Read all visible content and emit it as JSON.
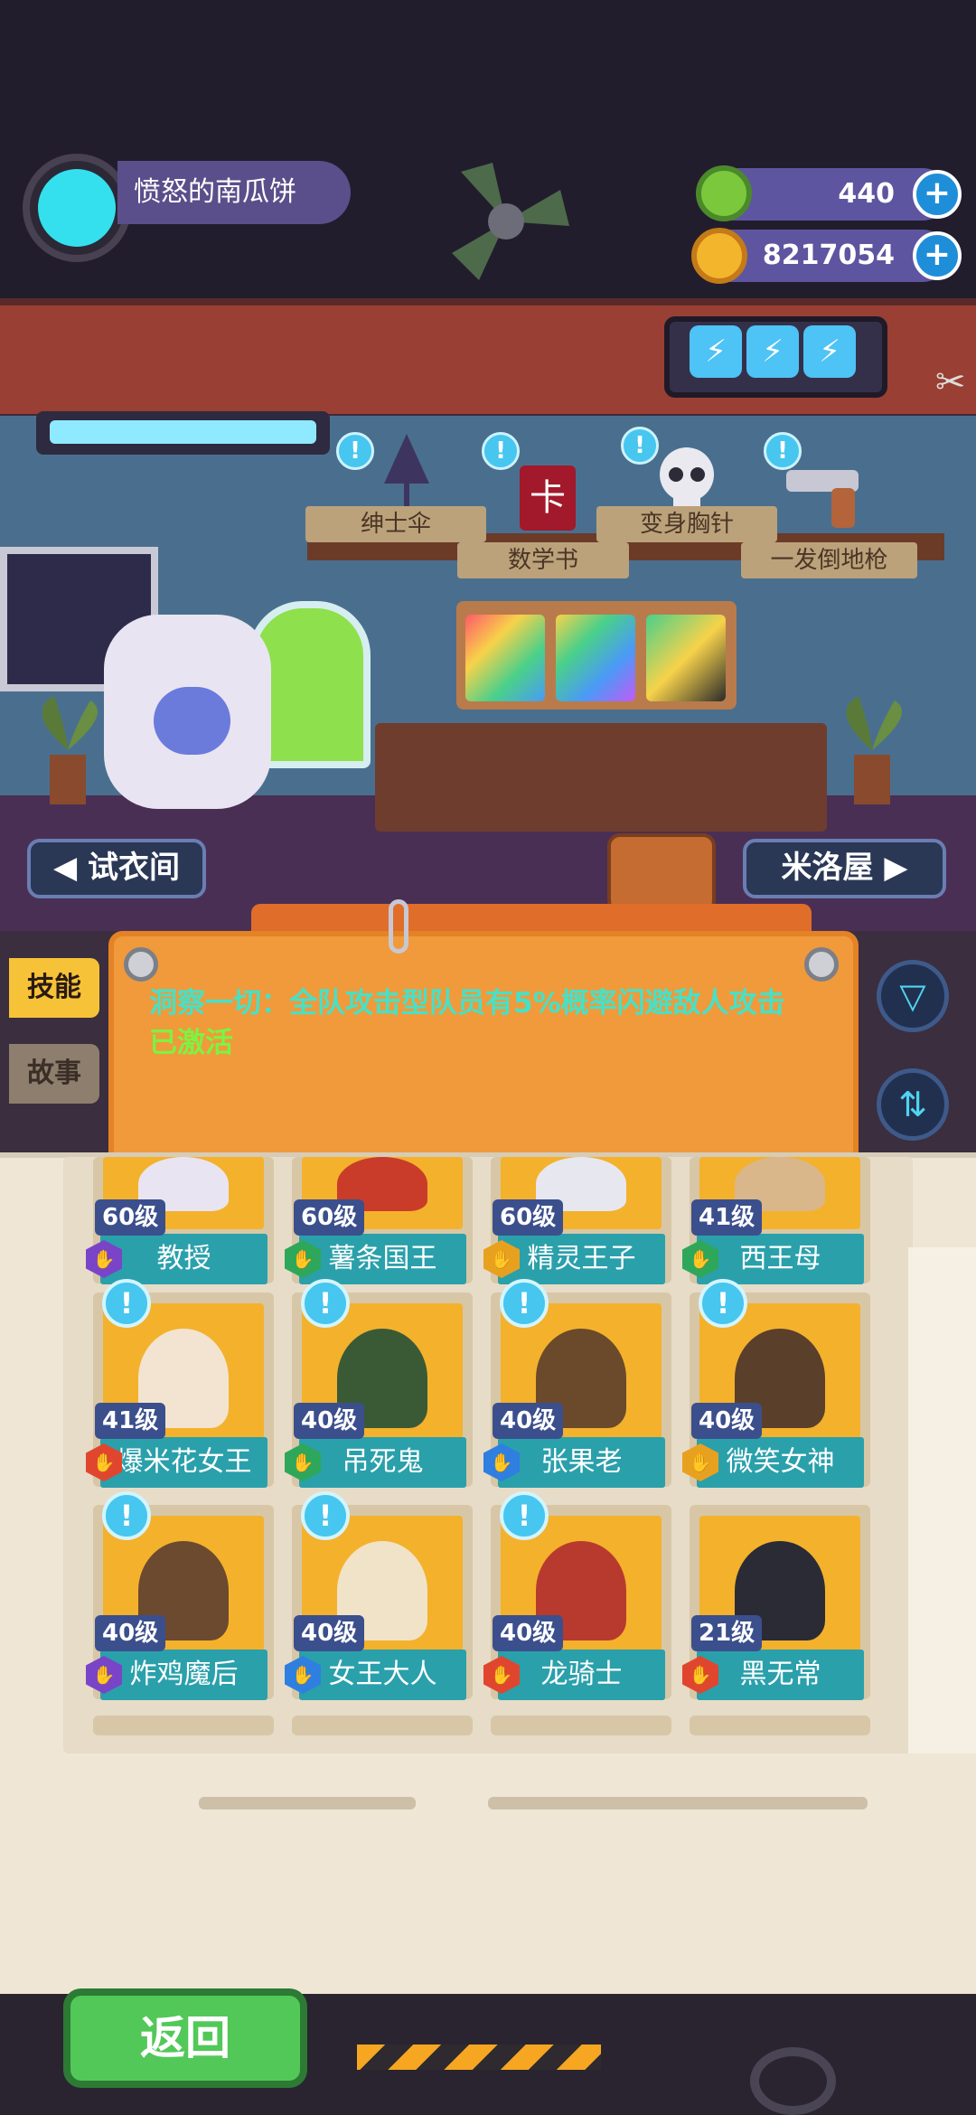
{
  "player": {
    "name": "愤怒的南瓜饼",
    "avatar_icon": "cat-face-icon"
  },
  "currencies": [
    {
      "name": "gems",
      "value": "440",
      "icon": "green-donut-icon",
      "color": "#7cc83c"
    },
    {
      "name": "coins",
      "value": "8217054",
      "icon": "gold-planet-icon",
      "color": "#f2b52c"
    }
  ],
  "energy": {
    "count": 3,
    "icon": "lightning-bolt-icon"
  },
  "shelf_items": [
    {
      "label": "绅士伞",
      "icon": "umbrella-icon"
    },
    {
      "label": "数学书",
      "icon": "book-icon"
    },
    {
      "label": "变身胸针",
      "icon": "skull-icon"
    },
    {
      "label": "一发倒地枪",
      "icon": "revolver-icon"
    }
  ],
  "nav": {
    "left": "试衣间",
    "right": "米洛屋"
  },
  "side_tabs": {
    "skill": "技能",
    "story": "故事"
  },
  "notice": {
    "text": "洞察一切：全队攻击型队员有5%概率闪避敌人攻击",
    "status": "已激活"
  },
  "heroes": [
    {
      "level": "60级",
      "name": "教授",
      "rank_color": "#7a44c8"
    },
    {
      "level": "60级",
      "name": "薯条国王",
      "rank_color": "#2ea75a"
    },
    {
      "level": "60级",
      "name": "精灵王子",
      "rank_color": "#e8a11f"
    },
    {
      "level": "41级",
      "name": "西王母",
      "rank_color": "#2ea75a"
    },
    {
      "level": "41级",
      "name": "爆米花女王",
      "rank_color": "#e0462e"
    },
    {
      "level": "40级",
      "name": "吊死鬼",
      "rank_color": "#2ea75a"
    },
    {
      "level": "40级",
      "name": "张果老",
      "rank_color": "#2f7fe0"
    },
    {
      "level": "40级",
      "name": "微笑女神",
      "rank_color": "#e8a11f"
    },
    {
      "level": "40级",
      "name": "炸鸡魔后",
      "rank_color": "#7a44c8"
    },
    {
      "level": "40级",
      "name": "女王大人",
      "rank_color": "#2f7fe0"
    },
    {
      "level": "40级",
      "name": "龙骑士",
      "rank_color": "#e0462e"
    },
    {
      "level": "21级",
      "name": "黑无常",
      "rank_color": "#e0462e"
    }
  ],
  "back_button": "返回"
}
